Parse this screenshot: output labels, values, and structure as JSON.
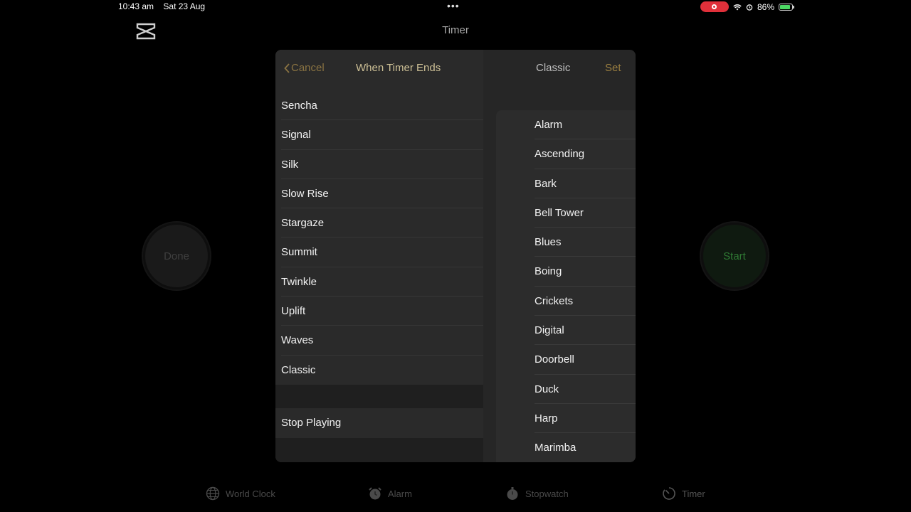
{
  "status_bar": {
    "time": "10:43 am",
    "date": "Sat 23 Aug",
    "dots": "•••",
    "battery": "86%",
    "battery_level": 0.86
  },
  "app": {
    "title": "Timer",
    "done_label": "Done",
    "start_label": "Start"
  },
  "tabbar": {
    "tabs": [
      {
        "label": "World Clock",
        "icon": "globe-icon"
      },
      {
        "label": "Alarm",
        "icon": "alarm-clock-icon"
      },
      {
        "label": "Stopwatch",
        "icon": "stopwatch-icon"
      },
      {
        "label": "Timer",
        "icon": "timer-icon",
        "active": true
      }
    ]
  },
  "modal": {
    "cancel_label": "Cancel",
    "title": "When Timer Ends",
    "selected_sound": "Classic",
    "set_label": "Set",
    "left_list": [
      "Sencha",
      "Signal",
      "Silk",
      "Slow Rise",
      "Stargaze",
      "Summit",
      "Twinkle",
      "Uplift",
      "Waves",
      "Classic"
    ],
    "stop_playing_label": "Stop Playing",
    "right_list": [
      "Alarm",
      "Ascending",
      "Bark",
      "Bell Tower",
      "Blues",
      "Boing",
      "Crickets",
      "Digital",
      "Doorbell",
      "Duck",
      "Harp",
      "Marimba"
    ]
  }
}
